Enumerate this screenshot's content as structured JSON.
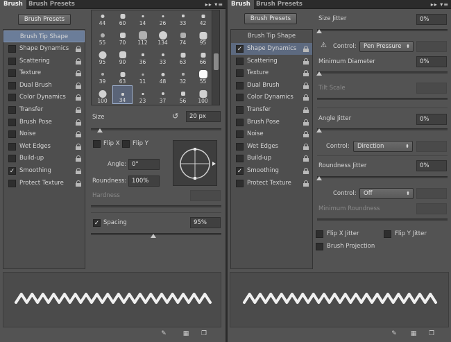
{
  "left": {
    "tabs": [
      "Brush",
      "Brush Presets"
    ],
    "presets_button": "Brush Presets",
    "header_item": "Brush Tip Shape",
    "items": [
      {
        "label": "Shape Dynamics",
        "checked": false
      },
      {
        "label": "Scattering",
        "checked": false
      },
      {
        "label": "Texture",
        "checked": false
      },
      {
        "label": "Dual Brush",
        "checked": false
      },
      {
        "label": "Color Dynamics",
        "checked": false
      },
      {
        "label": "Transfer",
        "checked": false
      },
      {
        "label": "Brush Pose",
        "checked": false
      },
      {
        "label": "Noise",
        "checked": false
      },
      {
        "label": "Wet Edges",
        "checked": false
      },
      {
        "label": "Build-up",
        "checked": false
      },
      {
        "label": "Smoothing",
        "checked": true
      },
      {
        "label": "Protect Texture",
        "checked": false
      }
    ],
    "brush_sizes": [
      [
        "44",
        "60",
        "14",
        "26",
        "33",
        "42"
      ],
      [
        "55",
        "70",
        "112",
        "134",
        "74",
        "95"
      ],
      [
        "95",
        "90",
        "36",
        "33",
        "63",
        "66"
      ],
      [
        "39",
        "63",
        "11",
        "48",
        "32",
        "55"
      ],
      [
        "100",
        "34",
        "23",
        "37",
        "56",
        "100"
      ]
    ],
    "selected_brush": "34",
    "size_label": "Size",
    "size_value": "20 px",
    "size_fraction": 0.07,
    "flip_x": "Flip X",
    "flip_y": "Flip Y",
    "angle_label": "Angle:",
    "angle_value": "0°",
    "roundness_label": "Roundness:",
    "roundness_value": "100%",
    "hardness_label": "Hardness",
    "spacing_label": "Spacing",
    "spacing_value": "95%",
    "spacing_fraction": 0.48,
    "spacing_checked": true
  },
  "right": {
    "tabs": [
      "Brush",
      "Brush Presets"
    ],
    "presets_button": "Brush Presets",
    "header_item": "Brush Tip Shape",
    "items": [
      {
        "label": "Shape Dynamics",
        "checked": true,
        "selected": true
      },
      {
        "label": "Scattering",
        "checked": false
      },
      {
        "label": "Texture",
        "checked": false
      },
      {
        "label": "Dual Brush",
        "checked": false
      },
      {
        "label": "Color Dynamics",
        "checked": false
      },
      {
        "label": "Transfer",
        "checked": false
      },
      {
        "label": "Brush Pose",
        "checked": false
      },
      {
        "label": "Noise",
        "checked": false
      },
      {
        "label": "Wet Edges",
        "checked": false
      },
      {
        "label": "Build-up",
        "checked": false
      },
      {
        "label": "Smoothing",
        "checked": true
      },
      {
        "label": "Protect Texture",
        "checked": false
      }
    ],
    "size_jitter_label": "Size Jitter",
    "size_jitter_value": "0%",
    "control_label": "Control:",
    "control1_value": "Pen Pressure",
    "min_diameter_label": "Minimum Diameter",
    "min_diameter_value": "0%",
    "tilt_scale_label": "Tilt Scale",
    "angle_jitter_label": "Angle Jitter",
    "angle_jitter_value": "0%",
    "control2_value": "Direction",
    "roundness_jitter_label": "Roundness Jitter",
    "roundness_jitter_value": "0%",
    "control3_value": "Off",
    "min_roundness_label": "Minimum Roundness",
    "flip_x_jitter": "Flip X Jitter",
    "flip_y_jitter": "Flip Y Jitter",
    "brush_projection": "Brush Projection"
  }
}
